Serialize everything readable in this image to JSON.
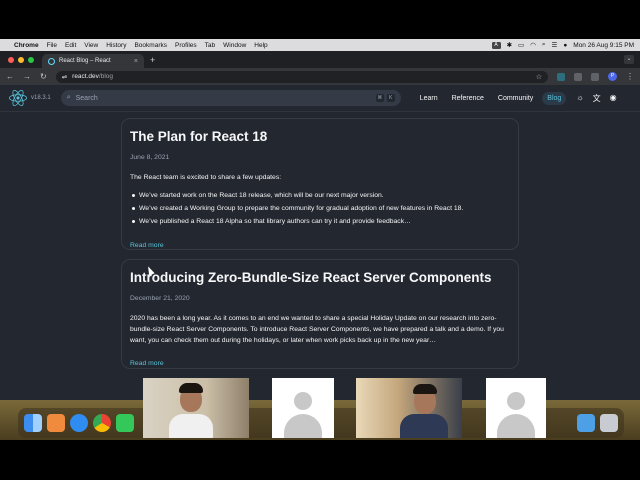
{
  "menubar": {
    "app": "Chrome",
    "items": [
      "File",
      "Edit",
      "View",
      "History",
      "Bookmarks",
      "Profiles",
      "Tab",
      "Window",
      "Help"
    ],
    "datetime": "Mon 26 Aug  9:15 PM",
    "keyboard": "A"
  },
  "browser": {
    "tab_title": "React Blog – React",
    "url_host": "react.dev",
    "url_path": "/blog",
    "profile_initial": "P"
  },
  "nav": {
    "version": "v18.3.1",
    "search_placeholder": "Search",
    "links": [
      "Learn",
      "Reference",
      "Community",
      "Blog"
    ],
    "active_link": "Blog"
  },
  "posts": [
    {
      "title": "The Plan for React 18",
      "date": "June 8, 2021",
      "intro": "The React team is excited to share a few updates:",
      "bullets": [
        "We’ve started work on the React 18 release, which will be our next major version.",
        "We’ve created a Working Group to prepare the community for gradual adoption of new features in React 18.",
        "We’ve published a React 18 Alpha so that library authors can try it and provide feedback…"
      ],
      "read_more": "Read more"
    },
    {
      "title": "Introducing Zero-Bundle-Size React Server Components",
      "date": "December 21, 2020",
      "intro": "2020 has been a long year. As it comes to an end we wanted to share a special Holiday Update on our research into zero-bundle-size React Server Components. To introduce React Server Components, we have prepared a talk and a demo. If you want, you can check them out during the holidays, or later when work picks back up in the new year…",
      "read_more": "Read more"
    }
  ],
  "colors": {
    "page_bg": "#23272f",
    "card_border": "#343a46",
    "text": "#f6f7f9",
    "muted": "#99a1b3",
    "link": "#58c4dc"
  }
}
